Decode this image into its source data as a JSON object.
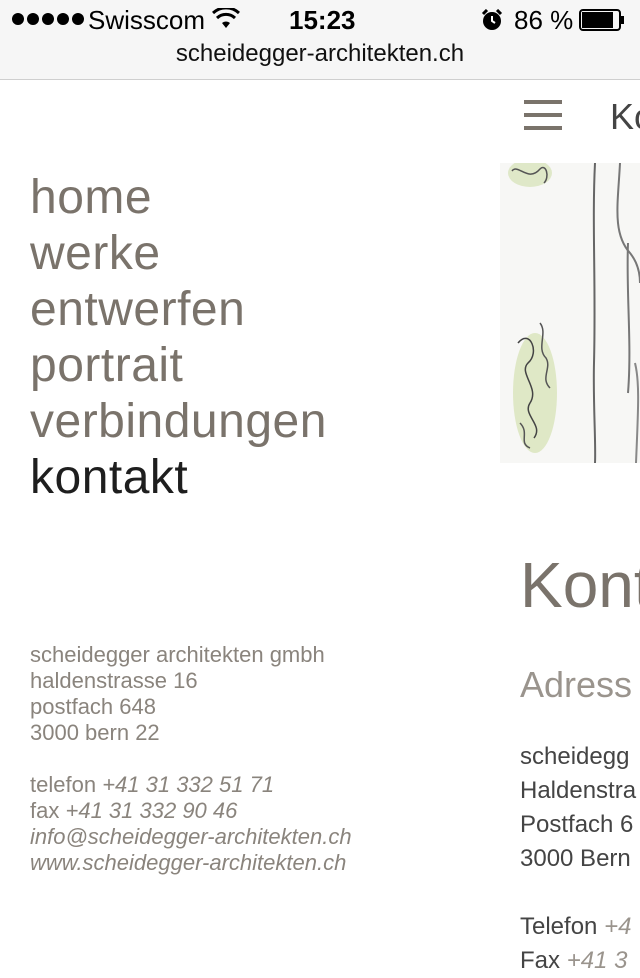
{
  "status": {
    "carrier": "Swisscom",
    "time": "15:23",
    "battery_percent": "86 %",
    "battery_level": 0.86
  },
  "browser": {
    "url": "scheidegger-architekten.ch"
  },
  "header": {
    "title_partial": "Ko"
  },
  "nav": {
    "items": [
      {
        "label": "home",
        "active": false
      },
      {
        "label": "werke",
        "active": false
      },
      {
        "label": "entwerfen",
        "active": false
      },
      {
        "label": "portrait",
        "active": false
      },
      {
        "label": "verbindungen",
        "active": false
      },
      {
        "label": "kontakt",
        "active": true
      }
    ]
  },
  "address": {
    "company": "scheidegger architekten gmbh",
    "street": "haldenstrasse 16",
    "postbox": "postfach 648",
    "city": "3000 bern 22",
    "phone_label": "telefon",
    "phone": "+41 31 332 51 71",
    "fax_label": "fax",
    "fax": "+41 31 332 90 46",
    "email": "info@scheidegger-architekten.ch",
    "web": "www.scheidegger-architekten.ch"
  },
  "content": {
    "title_partial": "Kont",
    "subtitle_partial": "Adress",
    "lines": [
      "scheidegg",
      "Haldenstra",
      "Postfach 6",
      "3000 Bern"
    ],
    "phone_label": "Telefon",
    "phone_partial": "+4",
    "fax_label": "Fax",
    "fax_partial": "+41 3"
  }
}
